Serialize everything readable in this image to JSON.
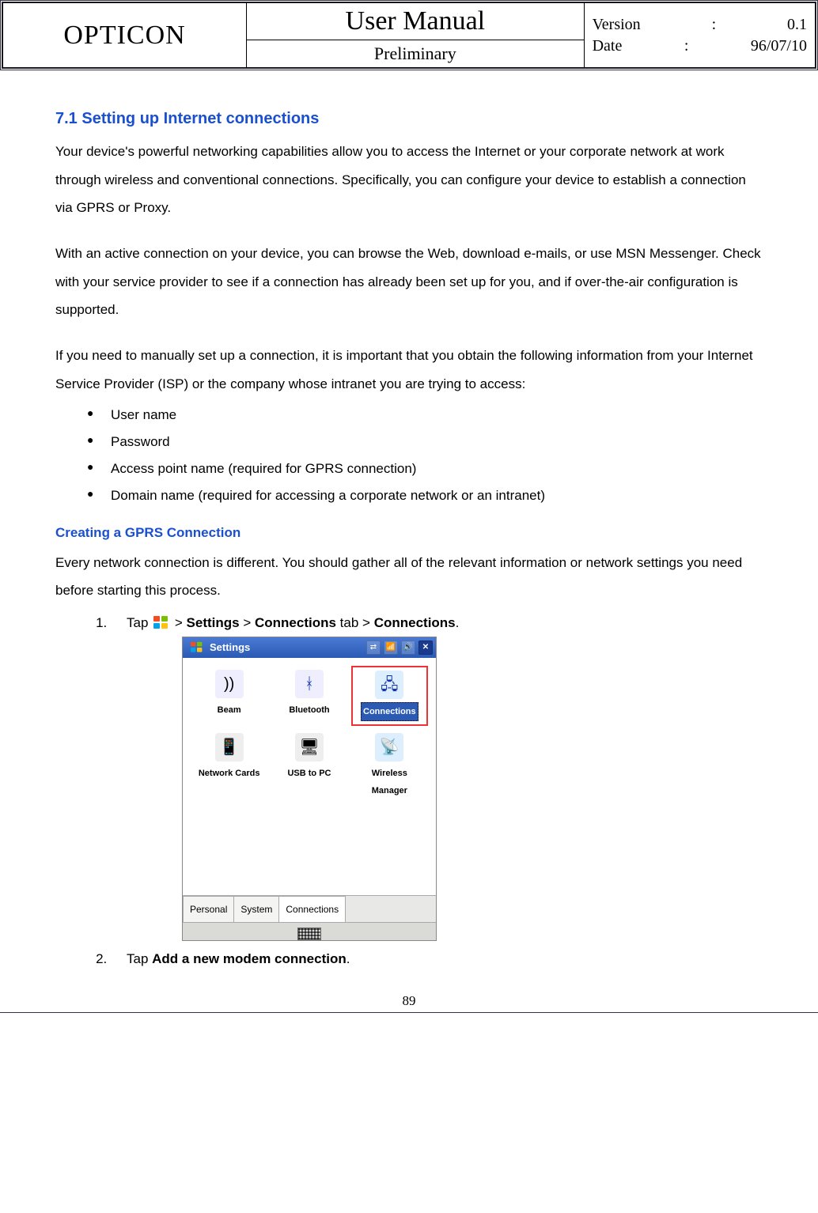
{
  "header": {
    "brand": "OPTICON",
    "title": "User Manual",
    "subtitle": "Preliminary",
    "version_label": "Version",
    "version_value": "0.1",
    "date_label": "Date",
    "date_value": "96/07/10"
  },
  "section": {
    "heading": "7.1 Setting up Internet connections",
    "para1": "Your device's powerful networking capabilities allow you to access the Internet or your corporate network at work through wireless and conventional connections. Specifically, you can configure your device to establish a connection via GPRS or Proxy.",
    "para2": "With an active connection on your device, you can browse the Web, download e-mails, or use MSN Messenger. Check with your service provider to see if a connection has already been set up for you, and if over-the-air configuration is supported.",
    "para3": "If you need to manually set up a connection, it is important that you obtain the following information from your Internet Service Provider (ISP) or the company whose intranet you are trying to access:",
    "bullets": [
      "User name",
      "Password",
      "Access point name (required for GPRS connection)",
      "Domain name (required for accessing a corporate network or an intranet)"
    ]
  },
  "sub": {
    "heading": "Creating a GPRS Connection",
    "para": "Every network connection is different. You should gather all of the relevant information or network settings you need before starting this process.",
    "step1_pre": "Tap ",
    "step1_s1": "Settings",
    "step1_s2": "Connections",
    "step1_tab": " tab > ",
    "step1_s3": "Connections",
    "step2_pre": "Tap ",
    "step2_bold": "Add a new modem connection",
    "gt": " > "
  },
  "device": {
    "title": "Settings",
    "items": [
      "Beam",
      "Bluetooth",
      "Connections",
      "Network Cards",
      "USB to PC",
      "Wireless Manager"
    ],
    "tabs": [
      "Personal",
      "System",
      "Connections"
    ]
  },
  "page_number": "89"
}
